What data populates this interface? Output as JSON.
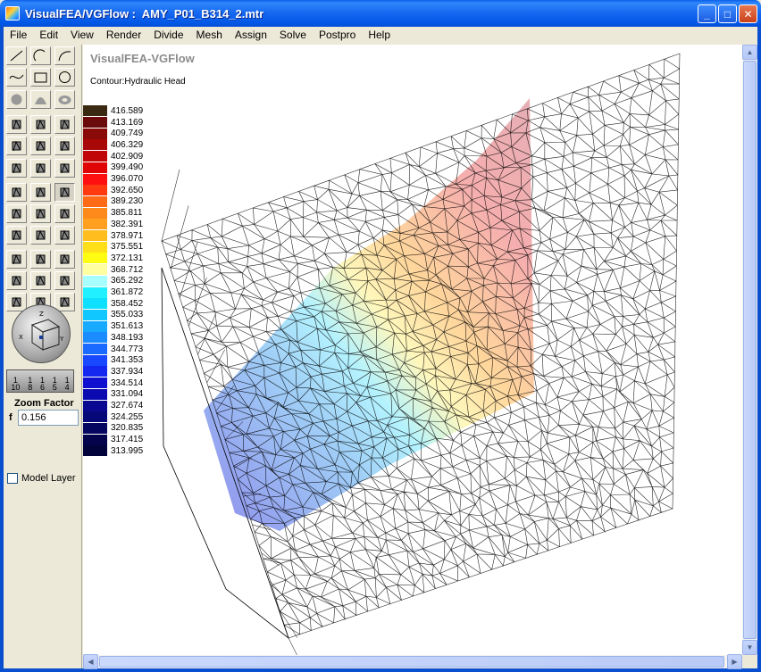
{
  "window": {
    "title": "VisualFEA/VGFlow :  AMY_P01_B314_2.mtr",
    "minimize": "_",
    "maximize": "□",
    "close": "✕"
  },
  "menu": [
    "File",
    "Edit",
    "View",
    "Render",
    "Divide",
    "Mesh",
    "Assign",
    "Solve",
    "Postpro",
    "Help"
  ],
  "toolbar": {
    "tools": [
      "line-icon",
      "arc-icon",
      "curve-icon",
      "spline-icon",
      "rectangle-icon",
      "circle-icon",
      "sphere-icon",
      "dome-icon",
      "torus-icon",
      "select-pointer-icon",
      "select-edge-icon",
      "select-surface-icon",
      "select-circle-icon",
      "select-node-icon",
      "select-block-icon",
      "move-node-icon",
      "select-face-icon",
      "select-volume-icon",
      "sweep-icon",
      "extrude-icon",
      "render-select-icon",
      "box-icon",
      "grid-box-icon",
      "rotate-box-icon",
      "block-icon",
      "cube-mesh-icon",
      "prism-icon",
      "mesh-layers-icon",
      "expand-icon",
      "shrink-icon",
      "xyz-icon",
      "xy-icon",
      "zx-icon",
      "zoom-fit-icon",
      "pan-icon",
      "center-icon"
    ],
    "zoom_ticks": [
      "1\n10",
      "1\n8",
      "1\n6",
      "1\n5",
      "1\n4"
    ],
    "zoom_factor_label": "Zoom Factor",
    "zoom_prefix": "f",
    "zoom_value": "0.156",
    "model_layer_label": "Model Layer"
  },
  "viewport": {
    "title": "VisualFEA-VGFlow",
    "subtitle": "Contour:Hydraulic Head",
    "legend": [
      {
        "value": "416.589",
        "color": "#3a2a12"
      },
      {
        "value": "413.169",
        "color": "#6b0a0a"
      },
      {
        "value": "409.749",
        "color": "#8a0a0a"
      },
      {
        "value": "406.329",
        "color": "#a80808"
      },
      {
        "value": "402.909",
        "color": "#c00606"
      },
      {
        "value": "399.490",
        "color": "#e00404"
      },
      {
        "value": "396.070",
        "color": "#ff1010"
      },
      {
        "value": "392.650",
        "color": "#ff3a10"
      },
      {
        "value": "389.230",
        "color": "#ff6a16"
      },
      {
        "value": "385.811",
        "color": "#ff8a1c"
      },
      {
        "value": "382.391",
        "color": "#ffa020"
      },
      {
        "value": "378.971",
        "color": "#ffbe1e"
      },
      {
        "value": "375.551",
        "color": "#ffde1a"
      },
      {
        "value": "372.131",
        "color": "#fffe12"
      },
      {
        "value": "368.712",
        "color": "#ffffa0"
      },
      {
        "value": "365.292",
        "color": "#a8ffff"
      },
      {
        "value": "361.872",
        "color": "#20f0ff"
      },
      {
        "value": "358.452",
        "color": "#10e0ff"
      },
      {
        "value": "355.033",
        "color": "#10c8ff"
      },
      {
        "value": "351.613",
        "color": "#18aaff"
      },
      {
        "value": "348.193",
        "color": "#1a8cff"
      },
      {
        "value": "344.773",
        "color": "#1a6aff"
      },
      {
        "value": "341.353",
        "color": "#1848ff"
      },
      {
        "value": "337.934",
        "color": "#1428f0"
      },
      {
        "value": "334.514",
        "color": "#1010d0"
      },
      {
        "value": "331.094",
        "color": "#0a0ab0"
      },
      {
        "value": "327.674",
        "color": "#080890"
      },
      {
        "value": "324.255",
        "color": "#060878"
      },
      {
        "value": "320.835",
        "color": "#040660"
      },
      {
        "value": "317.415",
        "color": "#03044c"
      },
      {
        "value": "313.995",
        "color": "#02033a"
      }
    ]
  }
}
